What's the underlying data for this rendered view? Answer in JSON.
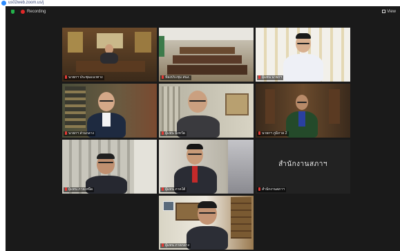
{
  "window": {
    "title": "us02web.zoom.us/j",
    "app_icon": "zoom-logo-icon"
  },
  "topbar": {
    "recording_label": "Recording",
    "view_label": "View"
  },
  "participants": [
    {
      "name": "นายกฯ ประชุมแนวทาง",
      "active": true
    },
    {
      "name": "ห้องประชุม สนง.",
      "active": false
    },
    {
      "name": "ผู้แทน นายกฯ",
      "active": false
    },
    {
      "name": "นายกฯ ส่วนกลาง",
      "active": false
    },
    {
      "name": "ผู้แทน จังหวัด",
      "active": false
    },
    {
      "name": "นายกฯ ภูมิภาค 2",
      "active": false
    },
    {
      "name": "ผู้แทน ภาคเหนือ",
      "active": false
    },
    {
      "name": "ผู้แทน ภาคใต้",
      "active": false
    },
    {
      "name": "สำนักงานสภาฯ",
      "active": false
    },
    {
      "name": "ผู้แทน ภาคกลาง",
      "active": false
    }
  ],
  "placeholder_text": "สำนักงานสภาฯ",
  "colors": {
    "active_border": "#c8d42a",
    "muted_mic": "#e53935",
    "background": "#1a1a1a"
  }
}
